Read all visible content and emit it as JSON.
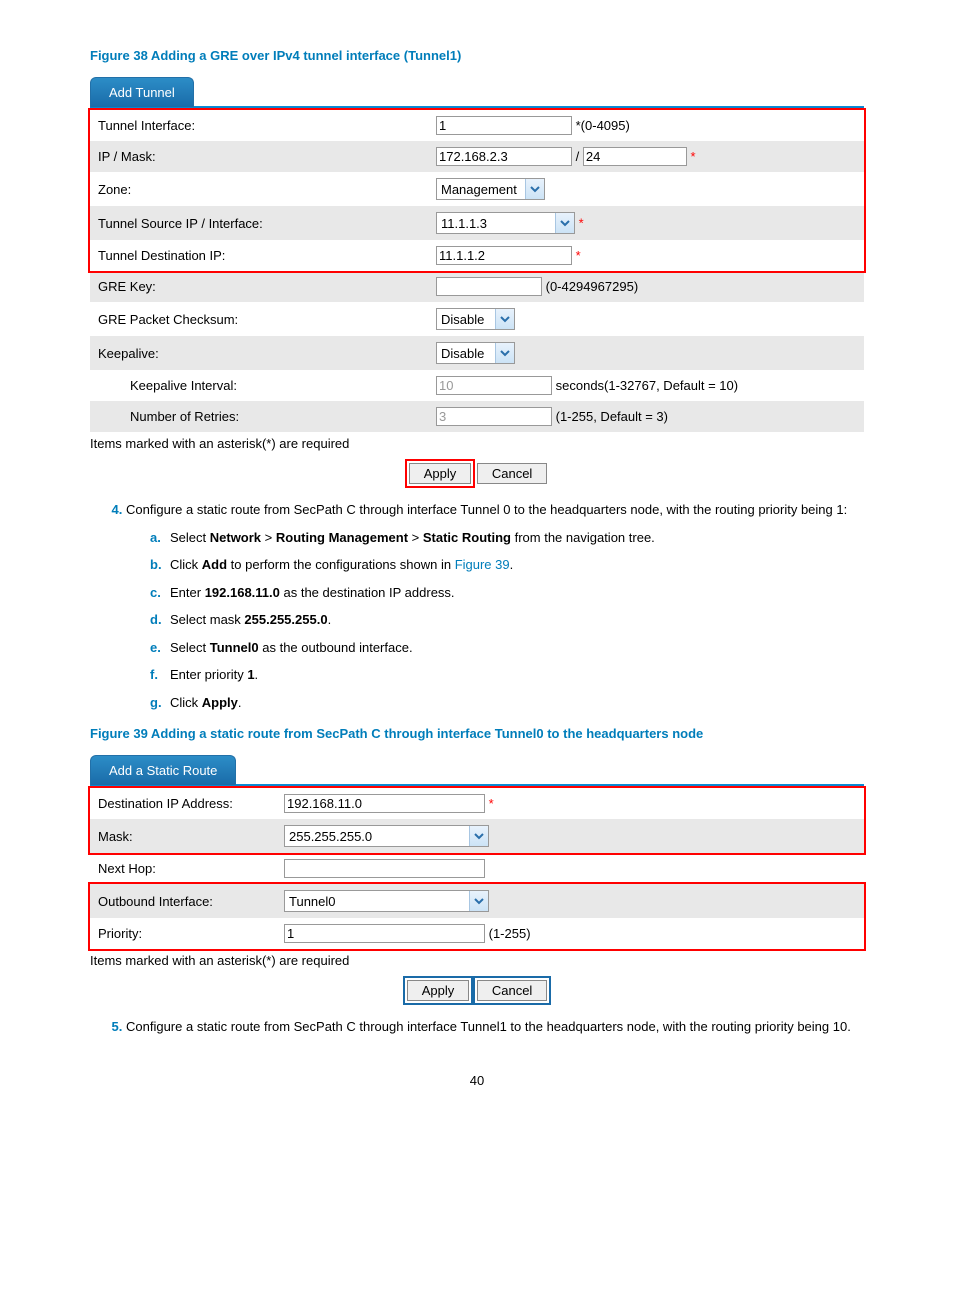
{
  "figure38_title": "Figure 38 Adding a GRE over IPv4 tunnel interface (Tunnel1)",
  "tab1_title": "Add Tunnel",
  "form1": {
    "tunnel_interface_label": "Tunnel Interface:",
    "tunnel_interface_value": "1",
    "tunnel_interface_hint": "*(0-4095)",
    "ip_mask_label": "IP / Mask:",
    "ip_value": "172.168.2.3",
    "mask_sep": "/",
    "mask_value": "24",
    "zone_label": "Zone:",
    "zone_value": "Management",
    "src_label": "Tunnel Source IP / Interface:",
    "src_value": "11.1.1.3",
    "dst_label": "Tunnel Destination IP:",
    "dst_value": "11.1.1.2",
    "gre_key_label": "GRE Key:",
    "gre_key_value": "",
    "gre_key_hint": "(0-4294967295)",
    "checksum_label": "GRE Packet Checksum:",
    "checksum_value": "Disable",
    "keepalive_label": "Keepalive:",
    "keepalive_value": "Disable",
    "ka_interval_label": "Keepalive Interval:",
    "ka_interval_value": "10",
    "ka_interval_hint": "seconds(1-32767, Default = 10)",
    "retries_label": "Number of Retries:",
    "retries_value": "3",
    "retries_hint": "(1-255, Default = 3)"
  },
  "required_note": "Items marked with an asterisk(*) are required",
  "apply_label": "Apply",
  "cancel_label": "Cancel",
  "step4_text_a": "Configure a static route from SecPath C through interface Tunnel 0 to the headquarters node, with the routing priority being 1:",
  "step4a_pre": "Select ",
  "step4a_b1": "Network",
  "step4a_sep": " > ",
  "step4a_b2": "Routing Management",
  "step4a_b3": "Static Routing",
  "step4a_post": " from the navigation tree.",
  "step4b_pre": "Click ",
  "step4b_b": "Add",
  "step4b_mid": " to perform the configurations shown in ",
  "step4b_link": "Figure 39",
  "step4b_post": ".",
  "step4c_pre": "Enter ",
  "step4c_b": "192.168.11.0",
  "step4c_post": " as the destination IP address.",
  "step4d_pre": "Select mask ",
  "step4d_b": "255.255.255.0",
  "step4d_post": ".",
  "step4e_pre": "Select ",
  "step4e_b": "Tunnel0",
  "step4e_post": " as the outbound interface.",
  "step4f_pre": "Enter priority ",
  "step4f_b": "1",
  "step4f_post": ".",
  "step4g_pre": "Click ",
  "step4g_b": "Apply",
  "step4g_post": ".",
  "figure39_title": "Figure 39 Adding a static route from SecPath C through interface Tunnel0 to the headquarters node",
  "tab2_title": "Add a Static Route",
  "form2": {
    "dest_label": "Destination IP Address:",
    "dest_value": "192.168.11.0",
    "mask_label": "Mask:",
    "mask_value": "255.255.255.0",
    "nexthop_label": "Next Hop:",
    "nexthop_value": "",
    "outif_label": "Outbound Interface:",
    "outif_value": "Tunnel0",
    "priority_label": "Priority:",
    "priority_value": "1",
    "priority_hint": "(1-255)"
  },
  "step5_text": "Configure a static route from SecPath C through interface Tunnel1 to the headquarters node, with the routing priority being 10.",
  "page_number": "40"
}
